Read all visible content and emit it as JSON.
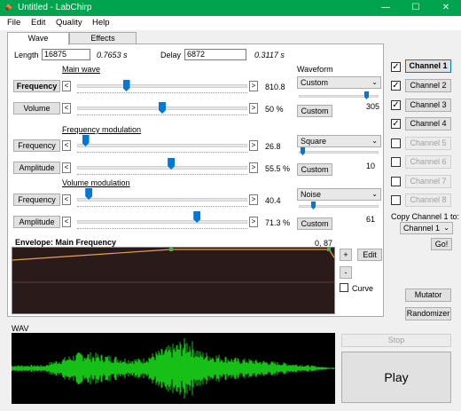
{
  "window": {
    "title": "Untitled - LabChirp",
    "minimize": "—",
    "maximize": "☐",
    "close": "✕"
  },
  "menu": [
    "File",
    "Edit",
    "Quality",
    "Help"
  ],
  "tabs": [
    "Wave",
    "Effects"
  ],
  "length": {
    "label": "Length",
    "value": "16875",
    "seconds": "0.7653 s"
  },
  "delay": {
    "label": "Delay",
    "value": "6872",
    "seconds": "0.3117 s"
  },
  "main_wave": {
    "section": "Main wave",
    "frequency": {
      "label": "Frequency",
      "value": "810.8",
      "level": 0.28
    },
    "volume": {
      "label": "Volume",
      "value": "50 %",
      "level": 0.5
    }
  },
  "freq_mod": {
    "section": "Frequency modulation",
    "frequency": {
      "label": "Frequency",
      "value": "26.8",
      "level": 0.03
    },
    "amplitude": {
      "label": "Amplitude",
      "value": "55.5 %",
      "level": 0.555
    }
  },
  "vol_mod": {
    "section": "Volume modulation",
    "frequency": {
      "label": "Frequency",
      "value": "40.4",
      "level": 0.05
    },
    "amplitude": {
      "label": "Amplitude",
      "value": "71.3 %",
      "level": 0.713
    }
  },
  "waveform": {
    "label": "Waveform",
    "selected": "Custom",
    "custom_button": "Custom",
    "value": "305"
  },
  "fm_waveform": {
    "selected": "Square",
    "custom_button": "Custom",
    "value": "10"
  },
  "vm_waveform": {
    "selected": "Noise",
    "custom_button": "Custom",
    "value": "61"
  },
  "envelope": {
    "title": "Envelope: Main Frequency",
    "point_readout": "0, 87",
    "add_button": "+",
    "remove_button": "-",
    "edit_button": "Edit",
    "curve_label": "Curve"
  },
  "channels": [
    {
      "label": "Channel 1",
      "checked": true,
      "enabled": true,
      "selected": true
    },
    {
      "label": "Channel 2",
      "checked": true,
      "enabled": true,
      "selected": false
    },
    {
      "label": "Channel 3",
      "checked": true,
      "enabled": true,
      "selected": false
    },
    {
      "label": "Channel 4",
      "checked": true,
      "enabled": true,
      "selected": false
    },
    {
      "label": "Channel 5",
      "checked": false,
      "enabled": false,
      "selected": false
    },
    {
      "label": "Channel 6",
      "checked": false,
      "enabled": false,
      "selected": false
    },
    {
      "label": "Channel 7",
      "checked": false,
      "enabled": false,
      "selected": false
    },
    {
      "label": "Channel 8",
      "checked": false,
      "enabled": false,
      "selected": false
    }
  ],
  "copy": {
    "label": "Copy Channel 1 to:",
    "selected": "Channel 1",
    "go_button": "Go!"
  },
  "mutator_button": "Mutator",
  "randomizer_button": "Randomizer",
  "wav": {
    "label": "WAV"
  },
  "stop_button": "Stop",
  "play_button": "Play",
  "colors": {
    "title_bar": "#00a44f",
    "slider_thumb": "#0078d7",
    "envelope_bg": "#2b1a1a",
    "waveform": "#16c016",
    "envelope_line": "#e8a050"
  }
}
